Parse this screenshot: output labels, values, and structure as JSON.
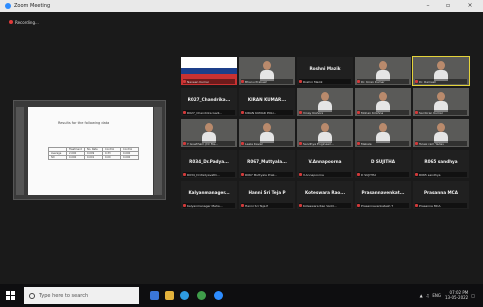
{
  "window": {
    "title": "Zoom Meeting",
    "minimize": "–",
    "maximize": "▫",
    "close": "×"
  },
  "recording": {
    "label": "Recording..."
  },
  "share": {
    "title": "Results for the following data",
    "table": [
      [
        "",
        "Treatment",
        "No. Rate",
        "Control",
        "Control"
      ],
      [
        "Average",
        "2.000",
        "0.009",
        "0.33",
        "0.000"
      ],
      [
        "SD",
        "0.000",
        "0.001",
        "0.00",
        "0.000"
      ]
    ]
  },
  "participants": [
    {
      "name": "",
      "label": "Naveen Kumar",
      "video": "banner"
    },
    {
      "name": "",
      "label": "Bhanu Prakash",
      "video": "person"
    },
    {
      "name": "Roshni Mazik",
      "label": "Roshni Mazik",
      "video": "none"
    },
    {
      "name": "",
      "label": "Dr. Kiran Kumar",
      "video": "person"
    },
    {
      "name": "",
      "label": "Dr. Ramesh",
      "video": "person",
      "active": true
    },
    {
      "name": "R027_Chandrika...",
      "label": "R027_Chandrika Gadi...",
      "video": "none"
    },
    {
      "name": "KIRAN KUMAR...",
      "label": "KIRAN KUMAR POLI...",
      "video": "none"
    },
    {
      "name": "",
      "label": "Vinay Kishore",
      "video": "person"
    },
    {
      "name": "",
      "label": "Mohan Krishna",
      "video": "person"
    },
    {
      "name": "",
      "label": "Sai Kiran Kumar",
      "video": "person"
    },
    {
      "name": "",
      "label": "Y Gowtham (Dr Me...",
      "video": "person"
    },
    {
      "name": "",
      "label": "Leela Kaveri",
      "video": "person"
    },
    {
      "name": "",
      "label": "Sandhya Engineeri...",
      "video": "person"
    },
    {
      "name": "",
      "label": "Mekale",
      "video": "person"
    },
    {
      "name": "",
      "label": "Tulasi ram Yadav",
      "video": "person"
    },
    {
      "name": "R034_Dr.Padya...",
      "label": "R034_Dr.Padyavathi...",
      "video": "none"
    },
    {
      "name": "R067_Muttyala...",
      "label": "R067 Muttyala Prak...",
      "video": "none"
    },
    {
      "name": "V.Annapoorna",
      "label": "V.Annapoorna",
      "video": "none"
    },
    {
      "name": "D SUJITHA",
      "label": "D SUJITHA",
      "video": "none"
    },
    {
      "name": "R065 sandhya",
      "label": "R065 sandhya",
      "video": "none"
    },
    {
      "name": "Kalyanmanager...",
      "label": "Kalyanmanager Meha...",
      "video": "none"
    },
    {
      "name": "Hanni Sri Teja P",
      "label": "Hanni Sri Teja P",
      "video": "none"
    },
    {
      "name": "Koteswara Rao...",
      "label": "Koteswara Rao Vadd...",
      "video": "none"
    },
    {
      "name": "Prasannavenkat...",
      "label": "Prasannavenkatesh T",
      "video": "none"
    },
    {
      "name": "Prasanna MCA",
      "label": "Prasanna MCA",
      "video": "none"
    }
  ],
  "taskbar": {
    "search_placeholder": "Type here to search",
    "tray_lang": "ENG",
    "time": "07:02 PM",
    "date": "13-05-2022"
  }
}
